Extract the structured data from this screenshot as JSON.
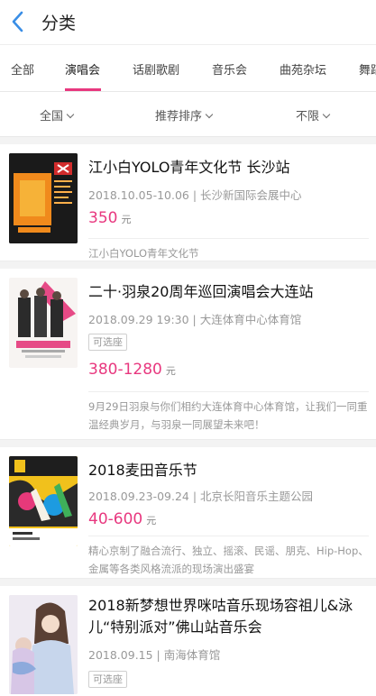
{
  "header": {
    "title": "分类"
  },
  "tabs": [
    {
      "label": "全部"
    },
    {
      "label": "演唱会"
    },
    {
      "label": "话剧歌剧"
    },
    {
      "label": "音乐会"
    },
    {
      "label": "曲苑杂坛"
    },
    {
      "label": "舞蹈"
    }
  ],
  "filters": {
    "city": "全国",
    "sort": "推荐排序",
    "time": "不限"
  },
  "items": [
    {
      "name": "江小白YOLO青年文化节 长沙站",
      "date": "2018.10.05-10.06",
      "venue": "长沙新国际会展中心",
      "price": "350",
      "unit": "元",
      "desc": "江小白YOLO青年文化节",
      "poster_text": "江小白·YOLO青年文化节"
    },
    {
      "name": "二十·羽泉20周年巡回演唱会大连站",
      "date": "2018.09.29 19:30",
      "venue": "大连体育中心体育馆",
      "tag": "可选座",
      "price": "380-1280",
      "unit": "元",
      "desc": "9月29日羽泉与你们相约大连体育中心体育馆，让我们一同重温经典岁月，与羽泉一同展望未来吧！"
    },
    {
      "name": "2018麦田音乐节",
      "date": "2018.09.23-09.24",
      "venue": "北京长阳音乐主题公园",
      "price": "40-600",
      "unit": "元",
      "desc": "精心京制了融合流行、独立、摇滚、民谣、朋克、Hip-Hop、金属等各类风格流派的现场演出盛宴",
      "poster_text": "9.23 — 9.24"
    },
    {
      "name": "2018新梦想世界咪咕音乐现场容祖儿&泳儿“特别派对”佛山站音乐会",
      "date": "2018.09.15",
      "venue": "南海体育馆",
      "tag": "可选座",
      "poster_text": "特别派对"
    }
  ],
  "colors": {
    "accent": "#e8387f",
    "back_arrow": "#3a8ee6"
  }
}
